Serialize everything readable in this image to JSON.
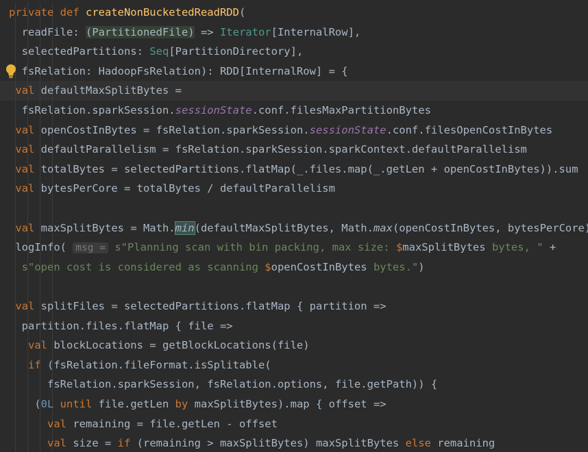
{
  "editor": {
    "colors": {
      "background": "#2b2b2b",
      "keyword": "#cc7832",
      "function": "#ffc66d",
      "string": "#6a8759",
      "number": "#6897bb",
      "implicit": "#9876aa",
      "default": "#a9b7c6"
    },
    "gutter_icon": "lightbulb-icon",
    "lines": [
      [
        [
          "kw",
          "private def "
        ],
        [
          "fn",
          "createNonBucketedReadRDD"
        ],
        [
          "",
          "("
        ]
      ],
      [
        [
          "",
          "  readFile: "
        ],
        [
          "param",
          "(PartitionedFile)"
        ],
        [
          "",
          " => "
        ],
        [
          "iter",
          "Iterator"
        ],
        [
          "",
          "[InternalRow],"
        ]
      ],
      [
        [
          "",
          "  selectedPartitions: "
        ],
        [
          "seq",
          "Seq"
        ],
        [
          "",
          "[PartitionDirectory],"
        ]
      ],
      [
        [
          "",
          "  fsRelation: HadoopFsRelation): RDD[InternalRow] = {"
        ]
      ],
      [
        [
          "kw",
          " val "
        ],
        [
          "",
          "defaultMaxSplitBytes ="
        ]
      ],
      [
        [
          "",
          "  fsRelation.sparkSession."
        ],
        [
          "im",
          "sessionState"
        ],
        [
          "",
          ".conf.filesMaxPartitionBytes"
        ]
      ],
      [
        [
          "kw",
          " val "
        ],
        [
          "",
          "openCostInBytes = fsRelation.sparkSession."
        ],
        [
          "im",
          "sessionState"
        ],
        [
          "",
          ".conf.filesOpenCostInBytes"
        ]
      ],
      [
        [
          "kw",
          " val "
        ],
        [
          "",
          "defaultParallelism = fsRelation.sparkSession.sparkContext.defaultParallelism"
        ]
      ],
      [
        [
          "kw",
          " val "
        ],
        [
          "",
          "totalBytes = selectedPartitions.flatMap(_.files.map(_.getLen + openCostInBytes)).sum"
        ]
      ],
      [
        [
          "kw",
          " val "
        ],
        [
          "",
          "bytesPerCore = totalBytes / defaultParallelism"
        ]
      ],
      [
        [
          "",
          ""
        ]
      ],
      [
        [
          "kw",
          " val "
        ],
        [
          "",
          "maxSplitBytes = Math."
        ],
        [
          "selit",
          "min"
        ],
        [
          "",
          "(defaultMaxSplitBytes, Math."
        ],
        [
          "it",
          "max"
        ],
        [
          "",
          "(openCostInBytes, bytesPerCore))"
        ]
      ],
      [
        [
          "",
          " logInfo( "
        ],
        [
          "hint",
          "msg ="
        ],
        [
          "",
          " "
        ],
        [
          "st",
          "s\"Planning scan with bin packing, max size: "
        ],
        [
          "kwb",
          "$"
        ],
        [
          "",
          "maxSplitBytes"
        ],
        [
          "st",
          " bytes, \""
        ],
        [
          "",
          " +"
        ]
      ],
      [
        [
          "st",
          "  s\"open cost is considered as scanning "
        ],
        [
          "kwb",
          "$"
        ],
        [
          "",
          "openCostInBytes"
        ],
        [
          "st",
          " bytes.\""
        ],
        [
          "",
          ")"
        ]
      ],
      [
        [
          "",
          ""
        ]
      ],
      [
        [
          "kw",
          " val "
        ],
        [
          "",
          "splitFiles = selectedPartitions.flatMap { partition =>"
        ]
      ],
      [
        [
          "",
          "  partition.files.flatMap { file =>"
        ]
      ],
      [
        [
          "kw",
          "   val "
        ],
        [
          "",
          "blockLocations = getBlockLocations(file)"
        ]
      ],
      [
        [
          "kw",
          "   if "
        ],
        [
          "",
          "(fsRelation.fileFormat.isSplitable("
        ]
      ],
      [
        [
          "",
          "      fsRelation.sparkSession, fsRelation.options, file.getPath)) {"
        ]
      ],
      [
        [
          "",
          "    ("
        ],
        [
          "nm",
          "0L"
        ],
        [
          "kw",
          " until "
        ],
        [
          "",
          "file.getLen "
        ],
        [
          "kw",
          "by "
        ],
        [
          "",
          "maxSplitBytes).map { offset =>"
        ]
      ],
      [
        [
          "kw",
          "      val "
        ],
        [
          "",
          "remaining = file.getLen - offset"
        ]
      ],
      [
        [
          "kw",
          "      val "
        ],
        [
          "",
          "size = "
        ],
        [
          "kw",
          "if "
        ],
        [
          "",
          "(remaining > maxSplitBytes) maxSplitBytes "
        ],
        [
          "kw",
          "else "
        ],
        [
          "",
          "remaining"
        ]
      ]
    ]
  }
}
